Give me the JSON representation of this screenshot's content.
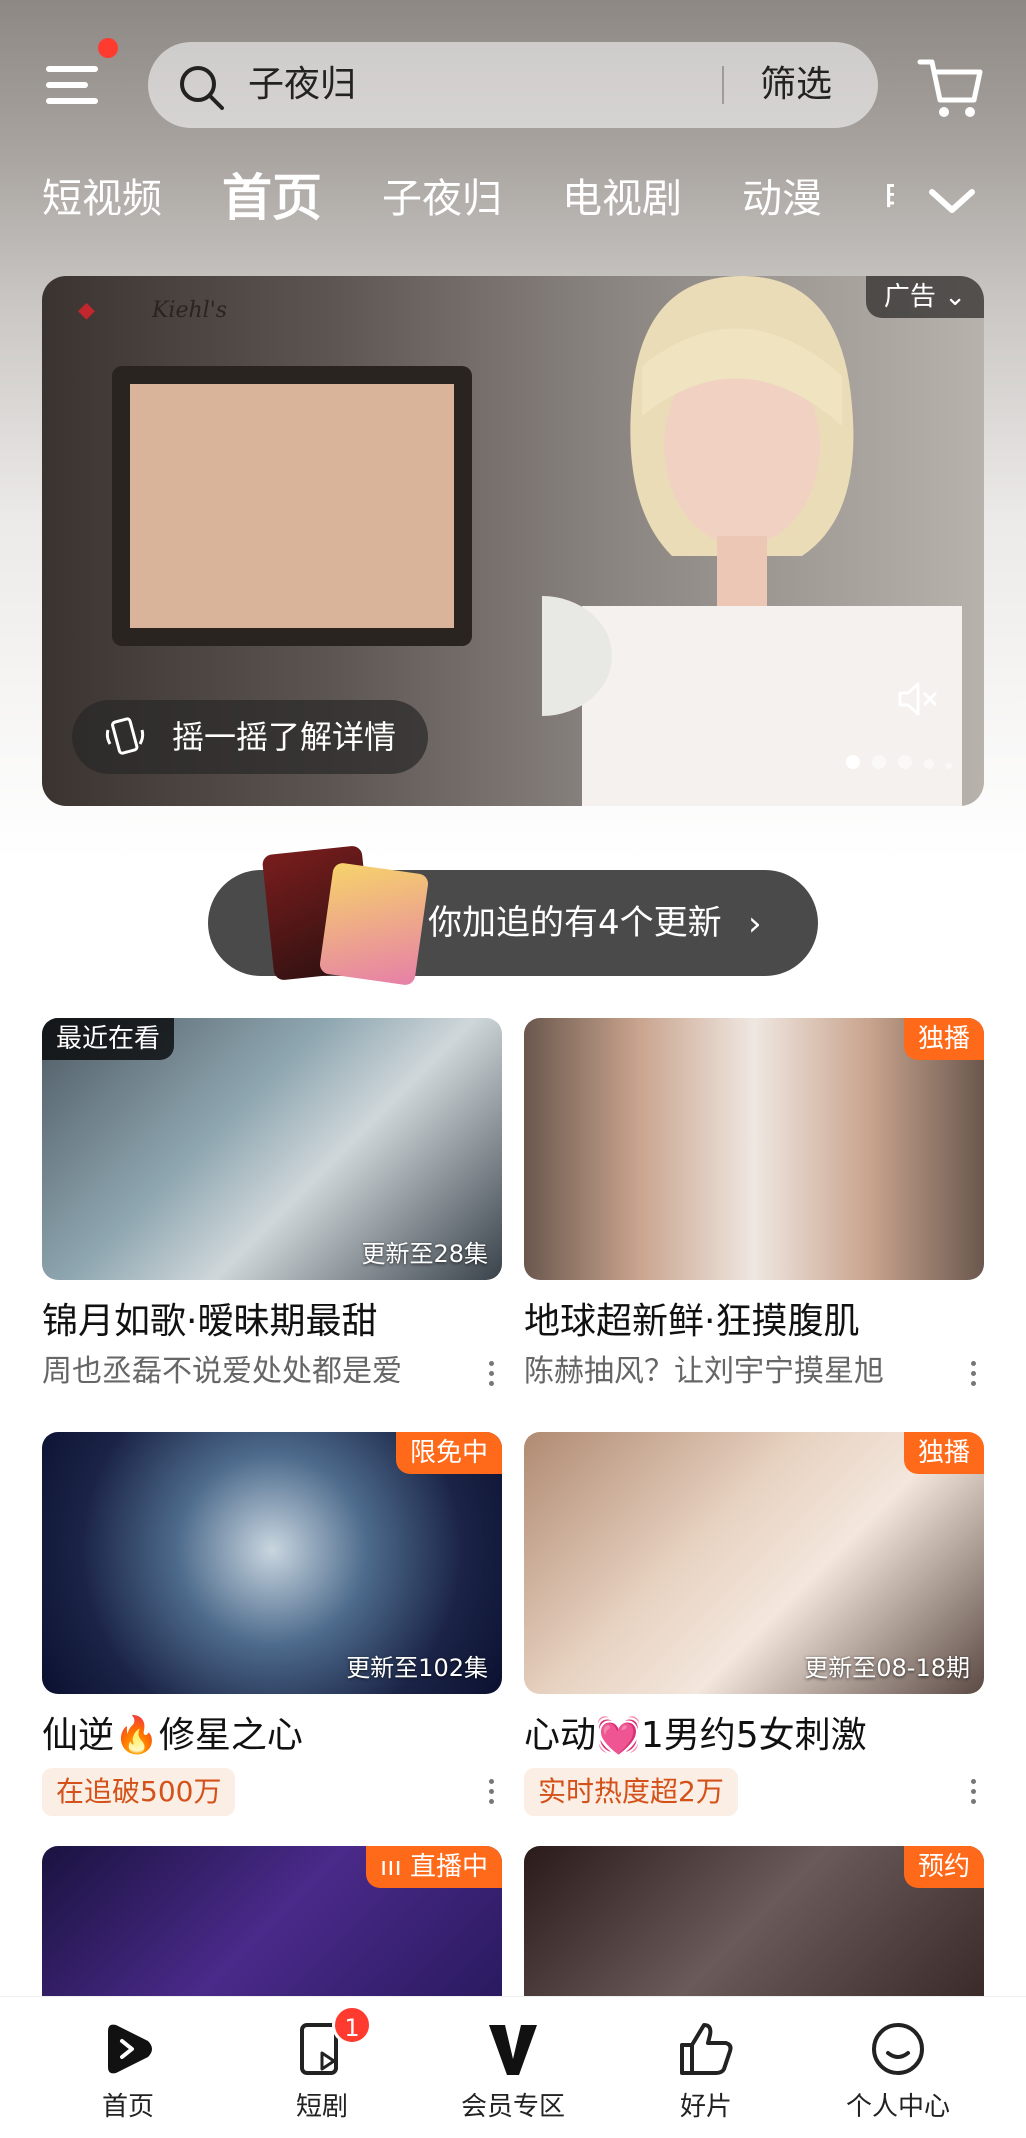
{
  "header": {
    "search_query": "子夜归",
    "filter_label": "筛选",
    "menu_icon": "menu-icon",
    "cart_icon": "cart-icon"
  },
  "tabs": [
    {
      "label": "短视频",
      "active": false
    },
    {
      "label": "首页",
      "active": true
    },
    {
      "label": "子夜归",
      "active": false
    },
    {
      "label": "电视剧",
      "active": false
    },
    {
      "label": "动漫",
      "active": false
    },
    {
      "label": "电",
      "active": false
    }
  ],
  "banner": {
    "ad_label": "广告",
    "brand_text": "Kiehl's",
    "shake_label": "摇一摇了解详情",
    "slide_count": 5,
    "active_slide": 1
  },
  "follow_pill": {
    "text": "你加追的有4个更新"
  },
  "cards": [
    {
      "tag_left": "最近在看",
      "tag_right": "",
      "overlay": "更新至28集",
      "title": "锦月如歌·暧昧期最甜",
      "subtitle": "周也丞磊不说爱处处都是爱",
      "badge": ""
    },
    {
      "tag_left": "",
      "tag_right": "独播",
      "overlay": "",
      "title": "地球超新鲜·狂摸腹肌",
      "subtitle": "陈赫抽风？让刘宇宁摸星旭",
      "badge": ""
    },
    {
      "tag_left": "",
      "tag_right": "限免中",
      "overlay": "更新至102集",
      "title": "仙逆🔥修星之心",
      "subtitle": "",
      "badge": "在追破500万"
    },
    {
      "tag_left": "",
      "tag_right": "独播",
      "overlay": "更新至08-18期",
      "title": "心动💓1男约5女刺激",
      "subtitle": "",
      "badge": "实时热度超2万"
    },
    {
      "tag_left": "",
      "tag_right": "直播中",
      "overlay": "",
      "title": "",
      "subtitle": "",
      "badge": ""
    },
    {
      "tag_left": "",
      "tag_right": "预约",
      "overlay": "",
      "title": "",
      "subtitle": "",
      "badge": ""
    }
  ],
  "bottom_nav": [
    {
      "label": "首页",
      "icon": "home-play-icon",
      "badge": ""
    },
    {
      "label": "短剧",
      "icon": "short-drama-icon",
      "badge": "1"
    },
    {
      "label": "会员专区",
      "icon": "vip-icon",
      "badge": ""
    },
    {
      "label": "好片",
      "icon": "thumbs-up-icon",
      "badge": ""
    },
    {
      "label": "个人中心",
      "icon": "profile-icon",
      "badge": ""
    }
  ],
  "colors": {
    "accent": "#ff6a1a",
    "badge_bg": "#fbeee4",
    "badge_text": "#d4521a",
    "notify": "#ff3b30"
  }
}
